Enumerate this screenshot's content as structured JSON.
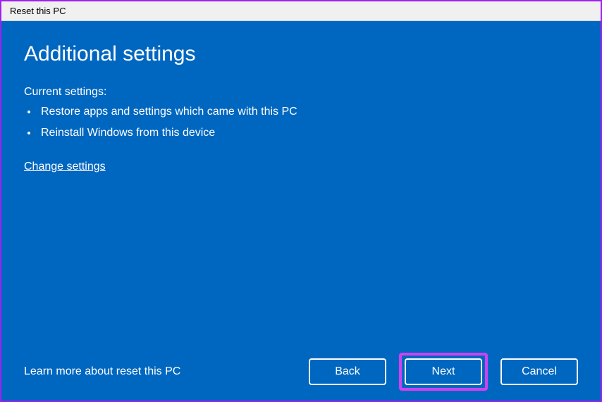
{
  "window": {
    "title": "Reset this PC"
  },
  "heading": "Additional settings",
  "section_label": "Current settings:",
  "bullets": [
    "Restore apps and settings which came with this PC",
    "Reinstall Windows from this device"
  ],
  "change_link": "Change settings",
  "learn_more": "Learn more about reset this PC",
  "buttons": {
    "back": "Back",
    "next": "Next",
    "cancel": "Cancel"
  }
}
